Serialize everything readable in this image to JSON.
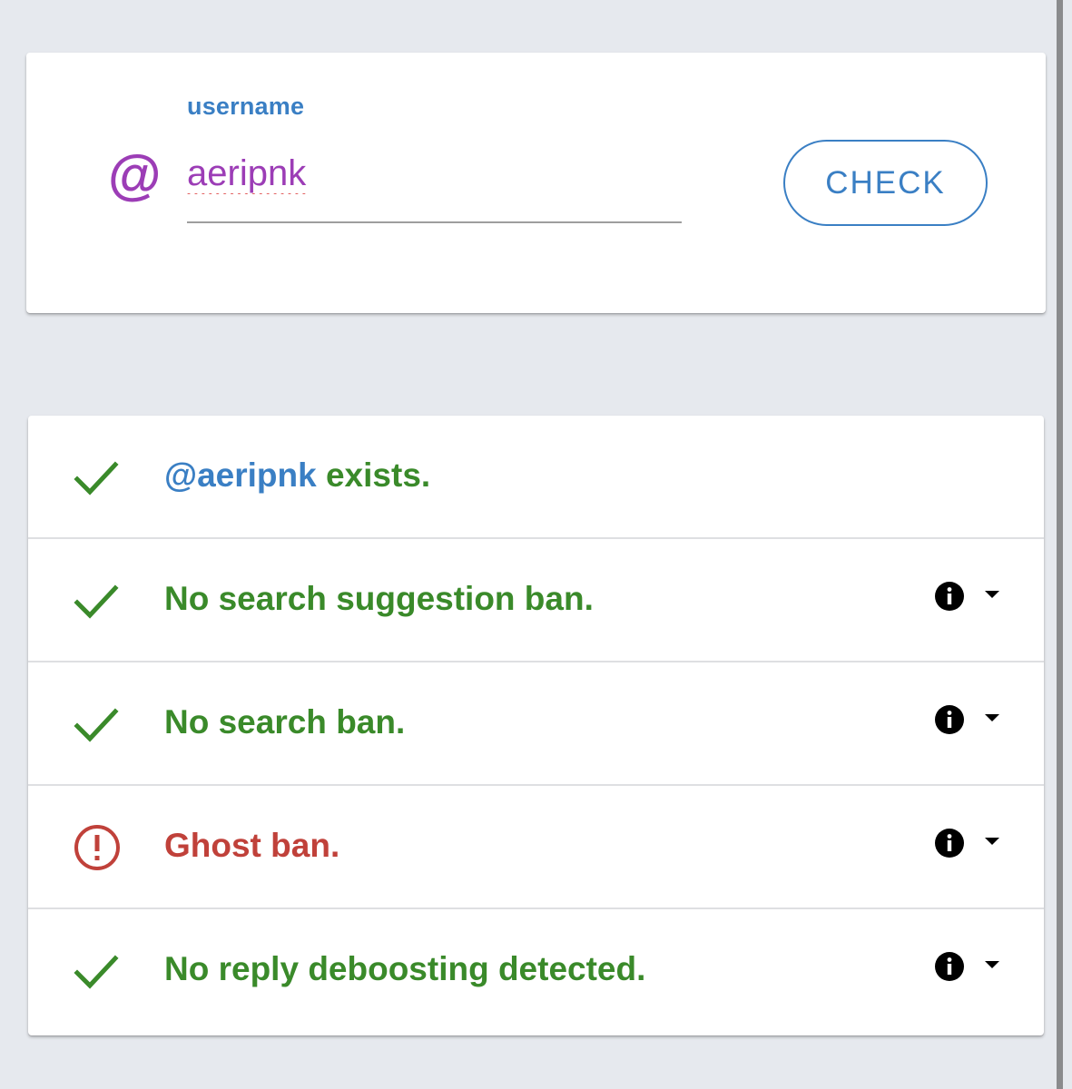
{
  "form": {
    "label": "username",
    "prefix": "@",
    "value": "aeripnk",
    "button_label": "CHECK"
  },
  "results": [
    {
      "status": "ok",
      "icon": "check-icon",
      "handle": "@aeripnk",
      "text": " exists.",
      "has_info": false
    },
    {
      "status": "ok",
      "icon": "check-icon",
      "text": "No search suggestion ban.",
      "has_info": true
    },
    {
      "status": "ok",
      "icon": "check-icon",
      "text": "No search ban.",
      "has_info": true
    },
    {
      "status": "error",
      "icon": "alert-circle-icon",
      "text": "Ghost ban.",
      "has_info": true
    },
    {
      "status": "ok",
      "icon": "check-icon",
      "text": "No reply deboosting detected.",
      "has_info": true
    }
  ],
  "colors": {
    "ok": "#3a8a2a",
    "error": "#c0413a",
    "accent": "#3a7fc4",
    "input_text": "#9c3db6",
    "background": "#e6e9ee"
  }
}
